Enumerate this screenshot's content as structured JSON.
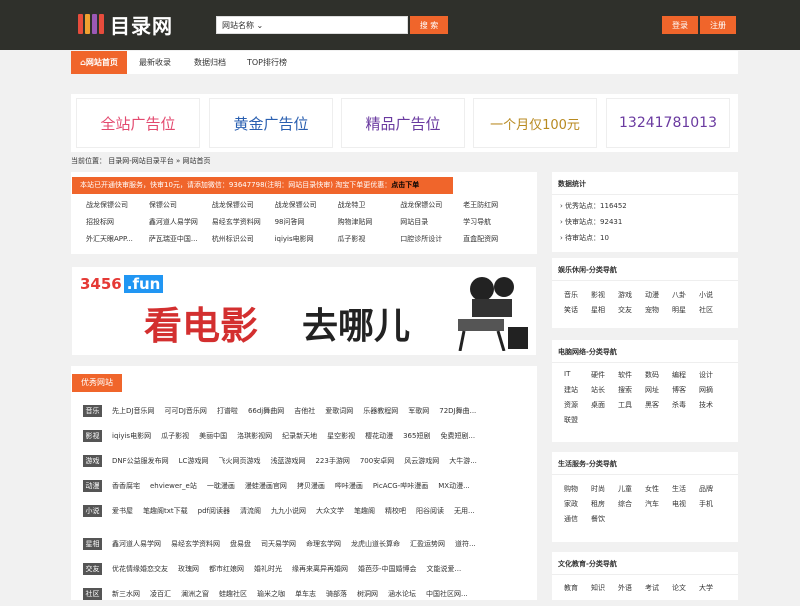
{
  "header": {
    "logo_text": "目录网",
    "search_select": "网站名称",
    "search_button": "搜 索",
    "login": "登录",
    "register": "注册"
  },
  "nav": [
    "网站首页",
    "最新收录",
    "数据归档",
    "TOP排行榜"
  ],
  "ads": [
    "全站广告位",
    "黄金广告位",
    "精品广告位",
    "一个月仅100元",
    "13241781013"
  ],
  "breadcrumb": "当前位置： 目录网-网站目录平台 » 网站首页",
  "notice": {
    "text": "本站已开通快审服务，快审10元，请添加微信：93647798(注明：网站目录快审) 淘宝下单更优惠：",
    "link": "点击下单"
  },
  "latest_links": [
    [
      "战龙保镖公司",
      "保镖公司",
      "战龙保镖公司",
      "战龙保镖公司",
      "战龙特卫",
      "战龙保镖公司",
      "老王防红网"
    ],
    [
      "招投标网",
      "鑫河道人易学网",
      "易经玄学资料网",
      "98问答网",
      "购物津贴网",
      "网站目录",
      "学习导航"
    ],
    [
      "外汇天眼APP...",
      "萨瓦瑞亚中国...",
      "杭州标识公司",
      "iqiyis电影网",
      "瓜子影视",
      "口腔诊所设计",
      "直盒配资网"
    ]
  ],
  "banner": {
    "brand": "3456",
    "tld": ".fun",
    "text1": "看电影",
    "text2": "去哪儿"
  },
  "section_title": "优秀网站",
  "categories": [
    {
      "tag": "音乐",
      "links": [
        "先上DJ音乐网",
        "可可DJ音乐网",
        "打谱啦",
        "66dj舞曲网",
        "吉他社",
        "爱歌词网",
        "乐器教程网",
        "军歌网",
        "72DJ舞曲..."
      ]
    },
    {
      "tag": "影视",
      "links": [
        "iqiyis电影网",
        "瓜子影视",
        "美丽中国",
        "洛琪影视网",
        "纪录新天地",
        "星空影视",
        "樱花动漫",
        "365短剧",
        "免费短剧..."
      ]
    },
    {
      "tag": "游戏",
      "links": [
        "DNF公益服发布网",
        "LC游戏网",
        "飞火网页游戏",
        "浅蓝游戏网",
        "223手游网",
        "700安卓网",
        "风云游戏网",
        "大牛游..."
      ]
    },
    {
      "tag": "动漫",
      "links": [
        "香香腐宅",
        "ehviewer_e站",
        "一耽漫画",
        "漫蛙漫画官网",
        "拷贝漫画",
        "哔咔漫画",
        "PicACG-哔咔漫画",
        "MX动漫..."
      ]
    },
    {
      "tag": "小说",
      "links": [
        "爱书屋",
        "笔趣阁txt下载",
        "pdf阅读器",
        "清流阁",
        "九九小说网",
        "大众文学",
        "笔趣阁",
        "精校吧",
        "阳谷阅读",
        "无用..."
      ]
    },
    {
      "tag": "星相",
      "links": [
        "鑫河道人易学网",
        "易经玄学资料网",
        "盘易盘",
        "司天易学网",
        "命理玄学网",
        "龙虎山道长算命",
        "汇盈运势网",
        "道符..."
      ]
    },
    {
      "tag": "交友",
      "links": [
        "优花情缘婚恋交友",
        "玫瑰网",
        "都市红娘网",
        "婚礼时光",
        "缘再来离异再婚网",
        "婚芭莎-中国婚博会",
        "文能说爱..."
      ]
    },
    {
      "tag": "社区",
      "links": [
        "新三水网",
        "凌百汇",
        "澜洲之窗",
        "蛙趣社区",
        "瑜米之咖",
        "单车志",
        "骑部落",
        "树洞网",
        "涵水论坛",
        "中国社区网..."
      ]
    }
  ],
  "stats": {
    "title": "数据统计",
    "items": [
      "优秀站点：116452",
      "快审站点：92431",
      "待审站点：10"
    ]
  },
  "side_sections": [
    {
      "title": "娱乐休闲-分类导航",
      "items": [
        "音乐",
        "影视",
        "游戏",
        "动漫",
        "八卦",
        "小说",
        "笑话",
        "星相",
        "交友",
        "宠物",
        "明星",
        "社区"
      ]
    },
    {
      "title": "电脑网络-分类导航",
      "items": [
        "IT",
        "硬件",
        "软件",
        "数码",
        "编程",
        "设计",
        "建站",
        "站长",
        "搜索",
        "网址",
        "博客",
        "网摘",
        "资源",
        "桌面",
        "工具",
        "黑客",
        "杀毒",
        "技术",
        "联盟"
      ]
    },
    {
      "title": "生活服务-分类导航",
      "items": [
        "购物",
        "时尚",
        "儿童",
        "女性",
        "生活",
        "品牌",
        "家政",
        "租房",
        "综合",
        "汽车",
        "电视",
        "手机",
        "通信",
        "餐饮"
      ]
    },
    {
      "title": "文化教育-分类导航",
      "items": [
        "教育",
        "知识",
        "外语",
        "考试",
        "论文",
        "大学"
      ]
    }
  ],
  "colors": {
    "accent": "#f0652b",
    "topbar": "#2f302b",
    "tag": "#555555"
  }
}
